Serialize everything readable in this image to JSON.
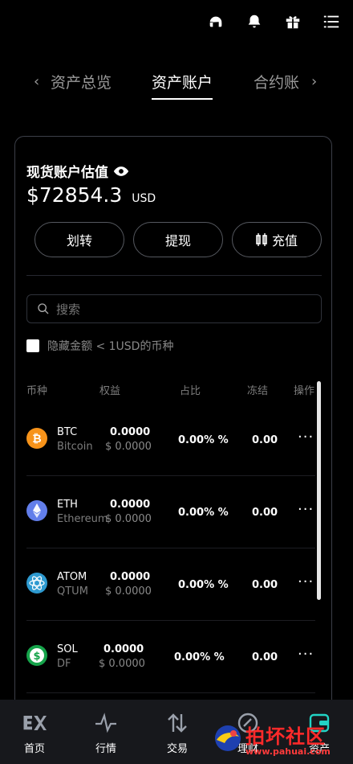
{
  "header_icons": [
    "headset-icon",
    "bell-icon",
    "gift-icon",
    "menu-icon"
  ],
  "tabs": [
    {
      "label": "资产总览"
    },
    {
      "label": "资产账户"
    },
    {
      "label": "合约账"
    }
  ],
  "account": {
    "title": "现货账户估值",
    "amount": "$72854.3",
    "unit": "USD"
  },
  "actions": {
    "transfer": "划转",
    "withdraw": "提现",
    "deposit": "充值"
  },
  "search": {
    "placeholder": "搜索"
  },
  "hide_small": {
    "label": "隐藏金额 < 1USD的币种",
    "checked": false
  },
  "table": {
    "headers": [
      "币种",
      "权益",
      "占比",
      "冻结",
      "操作"
    ],
    "rows": [
      {
        "symbol": "BTC",
        "name": "Bitcoin",
        "equity": "0.0000",
        "equity_usd": "$ 0.0000",
        "ratio": "0.00% %",
        "frozen": "0.00",
        "more": "···",
        "color": "#f7931a",
        "icon": "bitcoin-icon"
      },
      {
        "symbol": "ETH",
        "name": "Ethereum",
        "equity": "0.0000",
        "equity_usd": "$ 0.0000",
        "ratio": "0.00% %",
        "frozen": "0.00",
        "more": "···",
        "color": "#627eea",
        "icon": "ethereum-icon"
      },
      {
        "symbol": "ATOM",
        "name": "QTUM",
        "equity": "0.0000",
        "equity_usd": "$ 0.0000",
        "ratio": "0.00% %",
        "frozen": "0.00",
        "more": "···",
        "color": "#2e9ad0",
        "icon": "atom-icon"
      },
      {
        "symbol": "SOL",
        "name": "DF",
        "equity": "0.0000",
        "equity_usd": "$ 0.0000",
        "ratio": "0.00% %",
        "frozen": "0.00",
        "more": "···",
        "color": "#16a34a",
        "icon": "dollar-coin-icon"
      }
    ]
  },
  "nav": [
    {
      "label": "首页",
      "icon": "ex-logo-icon"
    },
    {
      "label": "行情",
      "icon": "pulse-icon"
    },
    {
      "label": "交易",
      "icon": "swap-arrows-icon"
    },
    {
      "label": "理财",
      "icon": "finance-icon"
    },
    {
      "label": "资产",
      "icon": "wallet-icon"
    }
  ],
  "watermark": {
    "title": "拍坏社区",
    "url": "www.pahuai.com"
  }
}
